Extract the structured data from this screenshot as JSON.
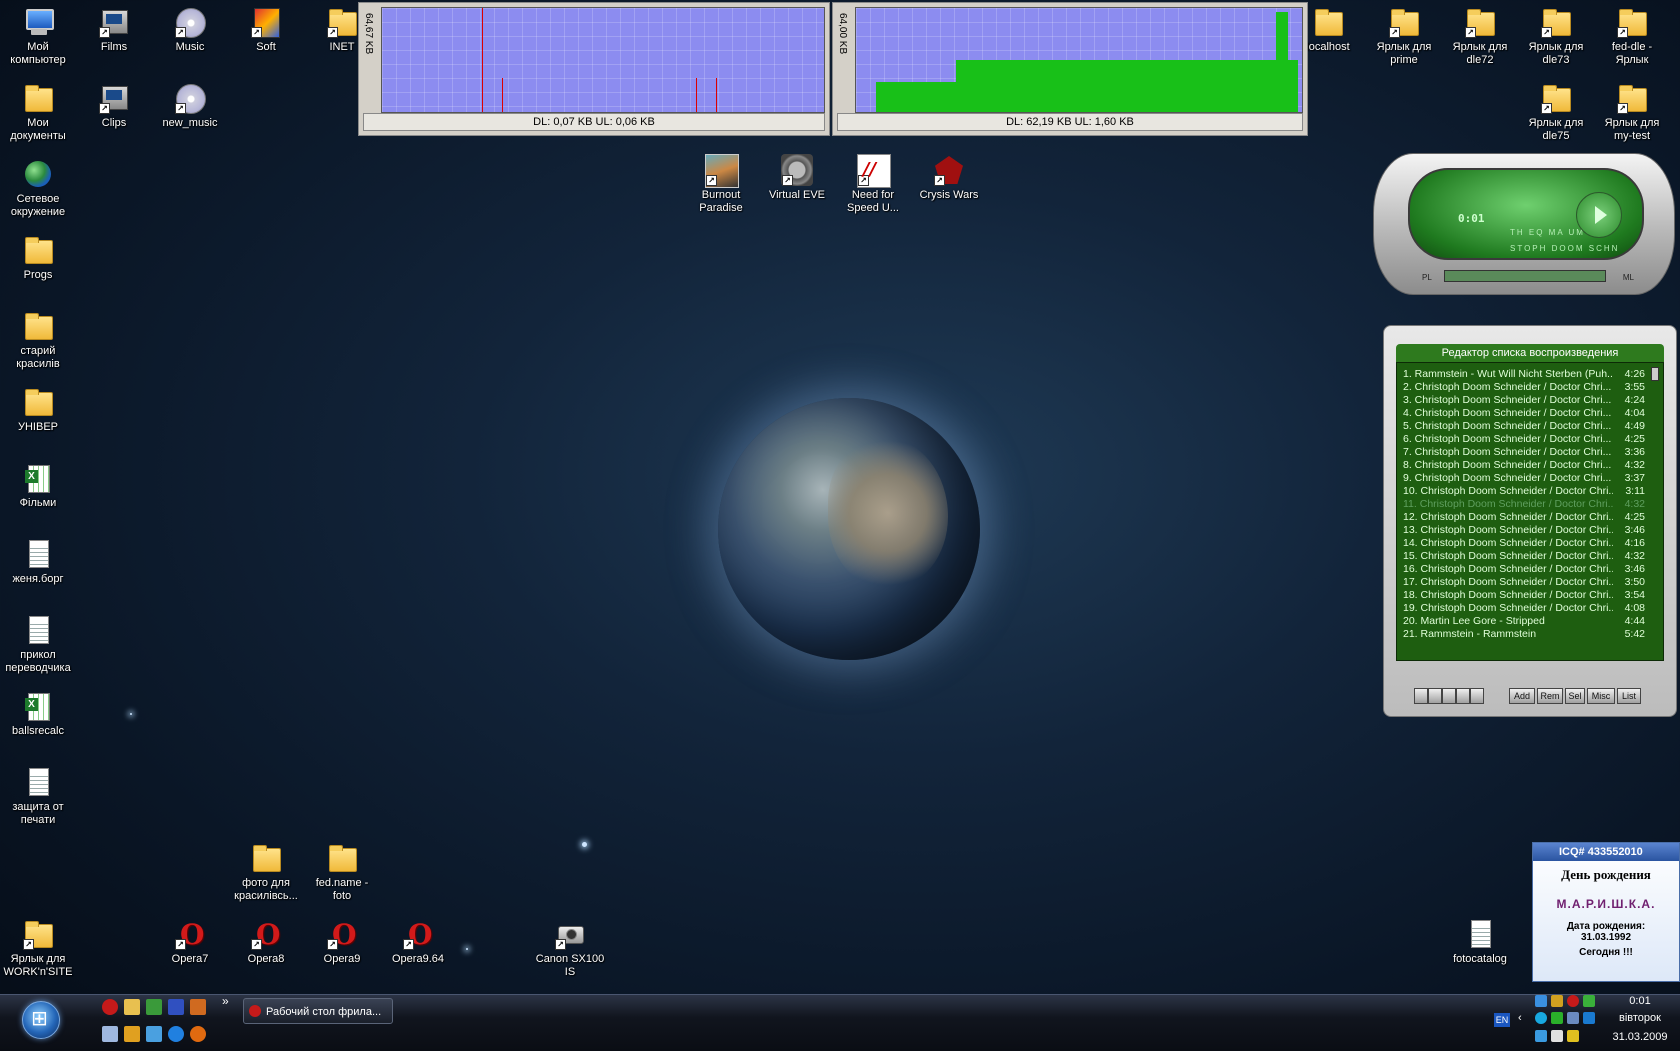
{
  "desktop": {
    "icons": [
      {
        "name": "my-computer-icon",
        "label": "Мой\nкомпьютер",
        "type": "pc"
      },
      {
        "name": "my-documents-icon",
        "label": "Мои\nдокументы",
        "type": "folder"
      },
      {
        "name": "network-icon",
        "label": "Сетевое\nокружение",
        "type": "globe"
      },
      {
        "name": "progs-folder-icon",
        "label": "Progs",
        "type": "folder"
      },
      {
        "name": "old-folder-icon",
        "label": "старий\nкрасилів",
        "type": "folder"
      },
      {
        "name": "univer-folder-icon",
        "label": "УНІВЕР",
        "type": "folder"
      },
      {
        "name": "films-excel-icon",
        "label": "Фільми",
        "type": "xls"
      },
      {
        "name": "zhenya-doc-icon",
        "label": "женя.борг",
        "type": "doc"
      },
      {
        "name": "prikol-doc-icon",
        "label": "прикол\nпереводчика",
        "type": "doc"
      },
      {
        "name": "ballsrecalc-icon",
        "label": "ballsrecalc",
        "type": "xls"
      },
      {
        "name": "print-protect-doc-icon",
        "label": "защита от\nпечати",
        "type": "doc"
      },
      {
        "name": "work-n-site-icon",
        "label": "Ярлык для\nWORK'n'SITE",
        "type": "folder"
      },
      {
        "name": "films-shortcut-icon",
        "label": "Films",
        "type": "film"
      },
      {
        "name": "clips-shortcut-icon",
        "label": "Clips",
        "type": "film"
      },
      {
        "name": "music-icon",
        "label": "Music",
        "type": "cd"
      },
      {
        "name": "new-music-icon",
        "label": "new_music",
        "type": "cd"
      },
      {
        "name": "soft-icon",
        "label": "Soft",
        "type": "softi"
      },
      {
        "name": "inet-folder-icon",
        "label": "INET",
        "type": "folder"
      },
      {
        "name": "burnout-paradise-icon",
        "label": "Burnout\nParadise",
        "type": "burn"
      },
      {
        "name": "virtual-eve-icon",
        "label": "Virtual EVE",
        "type": "veve"
      },
      {
        "name": "need-for-speed-icon",
        "label": "Need for\nSpeed U...",
        "type": "nfs"
      },
      {
        "name": "crysis-wars-icon",
        "label": "Crysis Wars",
        "type": "crysis"
      },
      {
        "name": "foto-folder-icon",
        "label": "фото для\nкрасилівсь...",
        "type": "folder"
      },
      {
        "name": "fed-name-foto-icon",
        "label": "fed.name -\nfoto",
        "type": "folder"
      },
      {
        "name": "opera7-icon",
        "label": "Opera7",
        "type": "opera"
      },
      {
        "name": "opera8-icon",
        "label": "Opera8",
        "type": "opera"
      },
      {
        "name": "opera9-icon",
        "label": "Opera9",
        "type": "opera"
      },
      {
        "name": "opera964-icon",
        "label": "Opera9.64",
        "type": "opera"
      },
      {
        "name": "canon-camera-icon",
        "label": "Canon SX100\nIS",
        "type": "cam"
      },
      {
        "name": "localhost-folder-icon",
        "label": "localhost",
        "type": "folder"
      },
      {
        "name": "prime-shortcut-icon",
        "label": "Ярлык для\nprime",
        "type": "folder"
      },
      {
        "name": "dle72-shortcut-icon",
        "label": "Ярлык для\ndle72",
        "type": "folder"
      },
      {
        "name": "dle73-shortcut-icon",
        "label": "Ярлык для\ndle73",
        "type": "folder"
      },
      {
        "name": "fed-dle-shortcut-icon",
        "label": "fed-dle -\nЯрлык",
        "type": "folder"
      },
      {
        "name": "dle75-shortcut-icon",
        "label": "Ярлык для\ndle75",
        "type": "folder"
      },
      {
        "name": "my-test-shortcut-icon",
        "label": "Ярлык для\nmy-test",
        "type": "folder"
      },
      {
        "name": "fotocatalog-icon",
        "label": "fotocatalog",
        "type": "doc"
      }
    ]
  },
  "bandwidth": {
    "left": {
      "scale": "64,67 KB",
      "status": "DL: 0,07 KB   UL: 0,06 KB"
    },
    "right": {
      "scale": "64,00 KB",
      "status": "DL: 62,19 KB   UL: 1,60 KB"
    }
  },
  "winamp": {
    "time": "0:01",
    "display1": "TH EQ MA UM CT",
    "display2": "STOPH DOOM SCHN",
    "pl": "PL",
    "ml": "ML",
    "playlist_title": "Редактор списка воспроизведения",
    "tracks": [
      {
        "t": "1. Rammstein - Wut Will Nicht Sterben (Puh...",
        "d": "4:26"
      },
      {
        "t": "2. Christoph Doom Schneider / Doctor Chri...",
        "d": "3:55"
      },
      {
        "t": "3. Christoph Doom Schneider / Doctor Chri...",
        "d": "4:24"
      },
      {
        "t": "4. Christoph Doom Schneider / Doctor Chri...",
        "d": "4:04"
      },
      {
        "t": "5. Christoph Doom Schneider / Doctor Chri...",
        "d": "4:49"
      },
      {
        "t": "6. Christoph Doom Schneider / Doctor Chri...",
        "d": "4:25"
      },
      {
        "t": "7. Christoph Doom Schneider / Doctor Chri...",
        "d": "3:36"
      },
      {
        "t": "8. Christoph Doom Schneider / Doctor Chri...",
        "d": "4:32"
      },
      {
        "t": "9. Christoph Doom Schneider / Doctor Chri...",
        "d": "3:37"
      },
      {
        "t": "10. Christoph Doom Schneider / Doctor Chri...",
        "d": "3:11"
      },
      {
        "t": "11. Christoph Doom Schneider / Doctor Chri...",
        "d": "4:32"
      },
      {
        "t": "12. Christoph Doom Schneider / Doctor Chri...",
        "d": "4:25"
      },
      {
        "t": "13. Christoph Doom Schneider / Doctor Chri...",
        "d": "3:46"
      },
      {
        "t": "14. Christoph Doom Schneider / Doctor Chri...",
        "d": "4:16"
      },
      {
        "t": "15. Christoph Doom Schneider / Doctor Chri...",
        "d": "4:32"
      },
      {
        "t": "16. Christoph Doom Schneider / Doctor Chri...",
        "d": "3:46"
      },
      {
        "t": "17. Christoph Doom Schneider / Doctor Chri...",
        "d": "3:50"
      },
      {
        "t": "18. Christoph Doom Schneider / Doctor Chri...",
        "d": "3:54"
      },
      {
        "t": "19. Christoph Doom Schneider / Doctor Chri...",
        "d": "4:08"
      },
      {
        "t": "20. Martin Lee Gore - Stripped",
        "d": "4:44"
      },
      {
        "t": "21. Rammstein - Rammstein",
        "d": "5:42"
      }
    ],
    "selected_track": 11,
    "buttons": [
      "Add",
      "Rem",
      "Sel",
      "Misc",
      "List"
    ]
  },
  "icq": {
    "header": "ICQ# 433552010",
    "title": "День рождения",
    "name": "М.А.Р.И.Ш.К.А.",
    "dob_label": "Дата рождения:",
    "dob": "31.03.1992",
    "today": "Сегодня !!!"
  },
  "taskbar": {
    "task_label": "Рабочий стол фрила...",
    "chevron": "»",
    "lang": "EN",
    "clock_time": "0:01",
    "clock_day": "вівторок",
    "clock_date": "31.03.2009"
  }
}
